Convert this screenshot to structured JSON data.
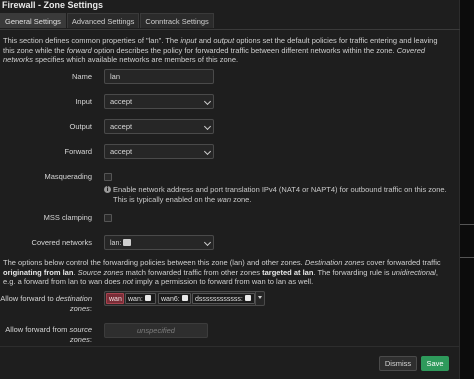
{
  "modal": {
    "title": "Firewall - Zone Settings",
    "tabs": [
      "General Settings",
      "Advanced Settings",
      "Conntrack Settings"
    ],
    "active_tab": "General Settings"
  },
  "intro": {
    "p1": "This section defines common properties of \"lan\". The ",
    "p1_i1": "input",
    "p1_b": " and ",
    "p1_i2": "output",
    "p1_c": " options set the default policies for traffic entering and leaving this zone while the ",
    "p1_i3": "forward",
    "p1_d": " option describes the policy for forwarded traffic between different networks within the zone. ",
    "p1_i4": "Covered networks",
    "p1_e": " specifies which available networks are members of this zone."
  },
  "fields": {
    "name_label": "Name",
    "name_value": "lan",
    "input_label": "Input",
    "input_value": "accept",
    "output_label": "Output",
    "output_value": "accept",
    "forward_label": "Forward",
    "forward_value": "accept",
    "masq_label": "Masquerading",
    "masq_checked": false,
    "masq_help_a": "Enable network address and port translation IPv4 (NAT4 or NAPT4) for outbound traffic on this zone. This is typically enabled on the ",
    "masq_help_i": "wan",
    "masq_help_b": " zone.",
    "mss_label": "MSS clamping",
    "mss_checked": false,
    "covered_label": "Covered networks",
    "covered_value": "lan:"
  },
  "forwarding": {
    "text_a": "The options below control the forwarding policies between this zone (lan) and other zones. ",
    "text_i1": "Destination zones",
    "text_b": " cover forwarded traffic ",
    "text_s1": "originating from lan",
    "text_c": ". ",
    "text_i2": "Source zones",
    "text_d": " match forwarded traffic from other zones ",
    "text_s2": "targeted at lan",
    "text_e": ". The forwarding rule is ",
    "text_i3": "unidirectional",
    "text_f": ", e.g. a forward from lan to wan does ",
    "text_i4": "not",
    "text_g": " imply a permission to forward from wan to lan as well.",
    "dest_label_a": "Allow forward to ",
    "dest_label_i": "destination zones",
    "dest_label_b": ":",
    "dest_zones": [
      "wan",
      "wan:",
      "wan6:",
      "dssssssssssss:"
    ],
    "src_label_a": "Allow forward from ",
    "src_label_i": "source zones",
    "src_label_b": ":",
    "src_placeholder": "unspecified"
  },
  "buttons": {
    "dismiss": "Dismiss",
    "save": "Save"
  },
  "colors": {
    "accent_save": "#2e9a5b",
    "zone_red": "#7a2d37"
  }
}
